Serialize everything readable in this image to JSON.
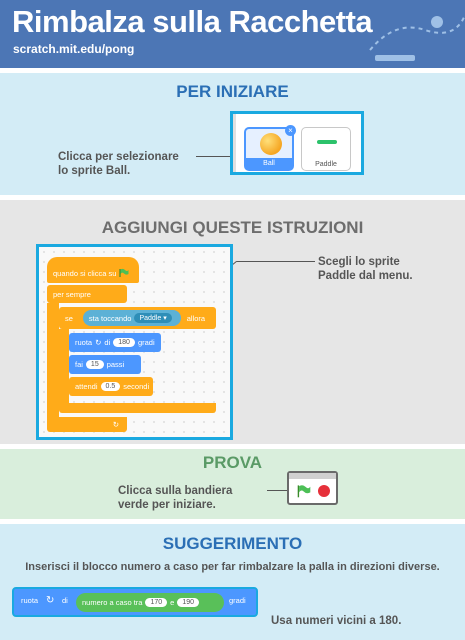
{
  "header": {
    "title": "Rimbalza sulla Racchetta",
    "url": "scratch.mit.edu/pong"
  },
  "section1": {
    "title": "PER INIZIARE",
    "caption_line1": "Clicca per selezionare",
    "caption_line2": "lo sprite Ball.",
    "sprites": [
      {
        "name": "Ball",
        "selected": true
      },
      {
        "name": "Paddle",
        "selected": false
      }
    ],
    "close_glyph": "×"
  },
  "section2": {
    "title": "AGGIUNGI QUESTE ISTRUZIONI",
    "callout_line1": "Scegli lo sprite",
    "callout_line2": "Paddle dal menu.",
    "blocks": {
      "when_flag": "quando si clicca su",
      "forever": "per sempre",
      "if": "se",
      "touching": "sta toccando",
      "touching_value": "Paddle",
      "then": "allora",
      "turn": "ruota",
      "turn_of": "di",
      "turn_value": "180",
      "degrees": "gradi",
      "move": "fai",
      "move_value": "15",
      "steps": "passi",
      "wait": "attendi",
      "wait_value": "0.5",
      "seconds": "secondi"
    }
  },
  "section3": {
    "title": "PROVA",
    "caption_line1": "Clicca sulla bandiera",
    "caption_line2": "verde per iniziare."
  },
  "section4": {
    "title": "SUGGERIMENTO",
    "description": "Inserisci il blocco numero a caso per far rimbalzare la palla in direzioni diverse.",
    "block": {
      "turn": "ruota",
      "of": "di",
      "random": "numero a caso tra",
      "from_value": "170",
      "and": "e",
      "to_value": "190",
      "degrees": "gradi"
    },
    "note": "Usa numeri vicini a 180."
  },
  "colors": {
    "header": "#4c76b5",
    "title_blue": "#2b6fb5",
    "highlight": "#1aa9e0",
    "events": "#ffab19",
    "motion": "#4c97ff",
    "sensing": "#5cb1d6",
    "operators": "#59c059"
  }
}
